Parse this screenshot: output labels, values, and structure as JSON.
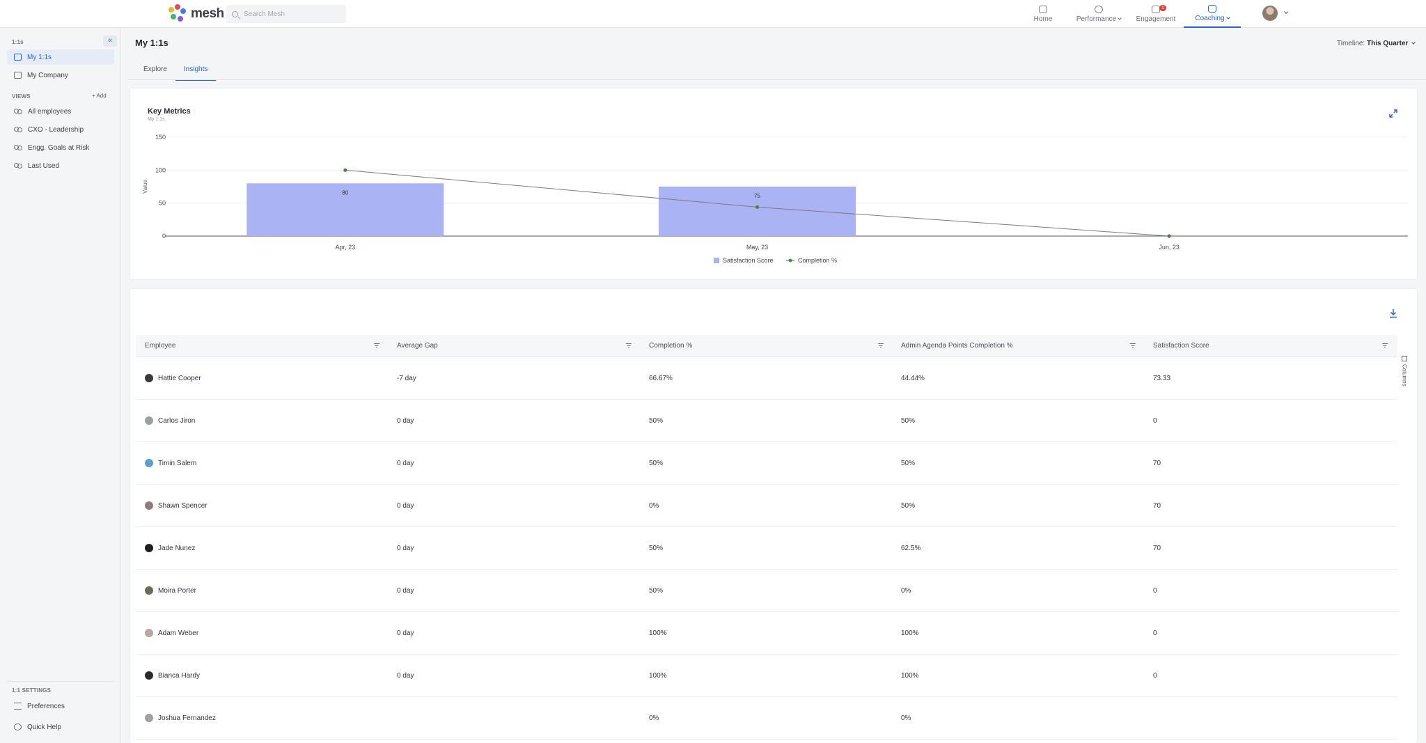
{
  "topbar": {
    "logo_text": "mesh",
    "search_placeholder": "Search Mesh",
    "nav": [
      {
        "label": "Home",
        "icon": "home-icon"
      },
      {
        "label": "Performance",
        "icon": "performance-icon"
      },
      {
        "label": "Engagement",
        "icon": "engagement-icon",
        "badge": "1"
      },
      {
        "label": "Coaching",
        "icon": "coaching-icon"
      }
    ]
  },
  "sidebar": {
    "section_title": "1:1s",
    "items": [
      {
        "label": "My 1:1s"
      },
      {
        "label": "My Company"
      }
    ],
    "views_title": "VIEWS",
    "views_add": "Add",
    "views": [
      {
        "label": "All employees"
      },
      {
        "label": "CXO - Leadership"
      },
      {
        "label": "Engg. Goals at Risk"
      },
      {
        "label": "Last Used"
      }
    ],
    "settings_title": "1:1 SETTINGS",
    "settings": [
      {
        "label": "Preferences"
      },
      {
        "label": "Quick Help"
      }
    ]
  },
  "page": {
    "title": "My 1:1s",
    "timeline_label": "Timeline:",
    "timeline_value": "This Quarter",
    "tabs": [
      {
        "label": "Explore"
      },
      {
        "label": "Insights"
      }
    ]
  },
  "chart_data": {
    "type": "bar",
    "title": "Key Metrics",
    "subtitle": "My 1:1s",
    "ylabel": "Value",
    "ylim": [
      0,
      150
    ],
    "yticks": [
      "0",
      "50",
      "100",
      "150"
    ],
    "categories": [
      "Apr, 23",
      "May, 23",
      "Jun, 23"
    ],
    "series": [
      {
        "name": "Satisfaction Score",
        "type": "bar",
        "values": [
          80,
          75,
          null
        ],
        "labels": [
          "80",
          "75",
          ""
        ],
        "color": "#aab4f5"
      },
      {
        "name": "Completion %",
        "type": "line",
        "values": [
          100,
          44,
          0
        ],
        "color": "#3d8a3a"
      }
    ],
    "legend": "bottom-center",
    "grid": true
  },
  "table": {
    "columns": [
      {
        "label": "Employee"
      },
      {
        "label": "Average Gap"
      },
      {
        "label": "Completion %"
      },
      {
        "label": "Admin Agenda Points Completion %"
      },
      {
        "label": "Satisfaction Score"
      }
    ],
    "columns_toggle": "Columns",
    "rows": [
      {
        "employee": "Hattie Cooper",
        "avg_gap": "-7 day",
        "completion": "66.67%",
        "admin_completion": "44.44%",
        "satisfaction": "73.33",
        "avatar_color": "#3a3a3a"
      },
      {
        "employee": "Carlos Jiron",
        "avg_gap": "0 day",
        "completion": "50%",
        "admin_completion": "50%",
        "satisfaction": "0",
        "avatar_color": "#9a9ea5"
      },
      {
        "employee": "Timin Salem",
        "avg_gap": "0 day",
        "completion": "50%",
        "admin_completion": "50%",
        "satisfaction": "70",
        "avatar_color": "#5f9ec9"
      },
      {
        "employee": "Shawn Spencer",
        "avg_gap": "0 day",
        "completion": "0%",
        "admin_completion": "50%",
        "satisfaction": "70",
        "avatar_color": "#8c7f74"
      },
      {
        "employee": "Jade Nunez",
        "avg_gap": "0 day",
        "completion": "50%",
        "admin_completion": "62.5%",
        "satisfaction": "70",
        "avatar_color": "#1f1f22"
      },
      {
        "employee": "Moira Porter",
        "avg_gap": "0 day",
        "completion": "50%",
        "admin_completion": "0%",
        "satisfaction": "0",
        "avatar_color": "#6d6b54"
      },
      {
        "employee": "Adam Weber",
        "avg_gap": "0 day",
        "completion": "100%",
        "admin_completion": "100%",
        "satisfaction": "0",
        "avatar_color": "#b9a99c"
      },
      {
        "employee": "Bianca Hardy",
        "avg_gap": "0 day",
        "completion": "100%",
        "admin_completion": "100%",
        "satisfaction": "0",
        "avatar_color": "#2b2b2b"
      },
      {
        "employee": "Joshua Fernandez",
        "avg_gap": "",
        "completion": "0%",
        "admin_completion": "0%",
        "satisfaction": "",
        "avatar_color": "#a3a0a6"
      }
    ]
  }
}
